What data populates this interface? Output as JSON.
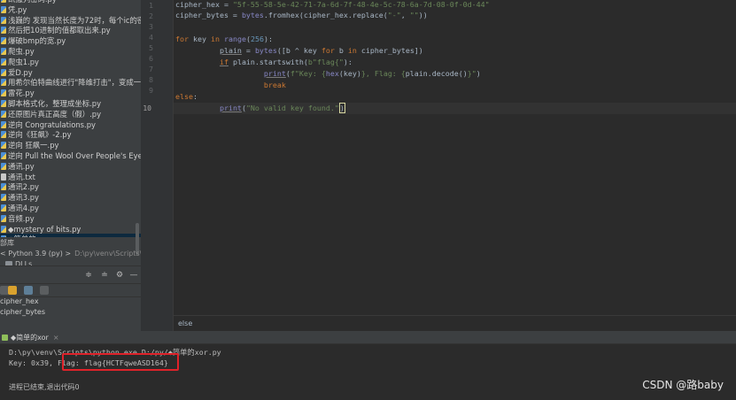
{
  "sidebar": {
    "files": [
      {
        "label": "凯撒列密码.py",
        "type": "py"
      },
      {
        "label": "凭.py",
        "type": "py"
      },
      {
        "label": "浅巍的 发现当然长度为72时，每个ic的密文都带",
        "type": "py"
      },
      {
        "label": "然后把10进制的值都取出来.py",
        "type": "py"
      },
      {
        "label": "爆破bmp的宽.py",
        "type": "py"
      },
      {
        "label": "爬虫.py",
        "type": "py"
      },
      {
        "label": "爬虫1.py",
        "type": "py"
      },
      {
        "label": "爱D.py",
        "type": "py"
      },
      {
        "label": "用希尔伯特曲线进行\"降维打击\"，变成一维的二进",
        "type": "py"
      },
      {
        "label": "雷花.py",
        "type": "py"
      },
      {
        "label": "脚本格式化，整理成坐标.py",
        "type": "py"
      },
      {
        "label": "还原图片真正高度（假）.py",
        "type": "py"
      },
      {
        "label": "逆向 Congratulations.py",
        "type": "py"
      },
      {
        "label": "逆向《狂飙》-2.py",
        "type": "py"
      },
      {
        "label": "逆向 狂飙一.py",
        "type": "py"
      },
      {
        "label": "逆向 Pull the Wool Over People's Eyes.py",
        "type": "py"
      },
      {
        "label": "通讯.py",
        "type": "py"
      },
      {
        "label": "通讯.txt",
        "type": "txt"
      },
      {
        "label": "通讯2.py",
        "type": "py"
      },
      {
        "label": "通讯3.py",
        "type": "py"
      },
      {
        "label": "通讯4.py",
        "type": "py"
      },
      {
        "label": "音频.py",
        "type": "py"
      },
      {
        "label": "◆mystery of bits.py",
        "type": "py"
      },
      {
        "label": "◆简单的xor.py",
        "type": "py",
        "selected": true
      }
    ],
    "external_libraries": "部库",
    "python_sdk": "< Python 3.9 (py) >",
    "python_sdk_path": "D:\\py\\venv\\Scripts\\python",
    "dlls": "DLLs",
    "structure_items": [
      "cipher_hex",
      "cipher_bytes"
    ]
  },
  "editor": {
    "line_numbers": [
      "1",
      "2",
      "3",
      "4",
      "5",
      "6",
      "7",
      "8",
      "9",
      "10"
    ],
    "footer_breadcrumb": "else"
  },
  "run": {
    "tab_label": "◆简单的xor",
    "command": "D:\\py\\venv\\Scripts\\python.exe D:/py/◆简单的xor.py",
    "result_prefix": "Key: 0x39, Flag: ",
    "result_flag": "flag{HCTFqweASD164}",
    "exit_message": "进程已结束,退出代码0"
  },
  "watermark": "CSDN @路baby",
  "colors": {
    "highlight_box": "#e0222a",
    "keyword": "#cc7832",
    "string": "#6a8759",
    "number": "#6897bb"
  }
}
